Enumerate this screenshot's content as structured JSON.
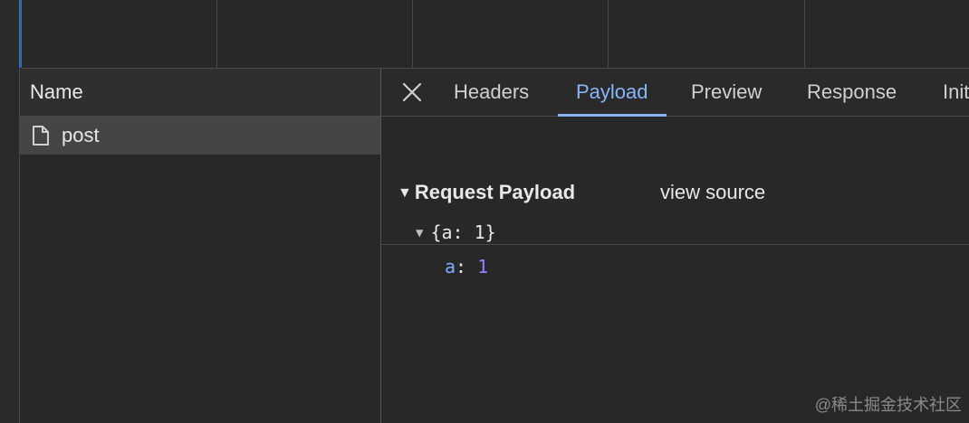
{
  "network_list": {
    "column_header": "Name",
    "rows": [
      {
        "name": "post",
        "icon": "file-icon"
      }
    ]
  },
  "details": {
    "close_icon": "close-icon",
    "tabs": [
      {
        "label": "Headers",
        "active": false
      },
      {
        "label": "Payload",
        "active": true
      },
      {
        "label": "Preview",
        "active": false
      },
      {
        "label": "Response",
        "active": false
      },
      {
        "label": "Init",
        "active": false
      }
    ],
    "payload": {
      "section_title": "Request Payload",
      "view_source": "view source",
      "object_summary": "{a: 1}",
      "property_key": "a",
      "property_sep": ": ",
      "property_value": "1"
    }
  },
  "watermark": "@稀土掘金技术社区",
  "colors": {
    "accent_blue": "#8ab4f8",
    "selection_row": "#454545",
    "left_accent": "#1a73c9",
    "key_color": "#7cacf8",
    "number_color": "#9980ff"
  }
}
